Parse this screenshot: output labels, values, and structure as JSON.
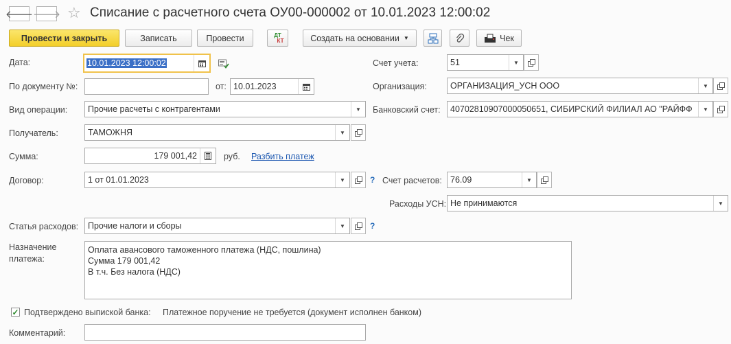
{
  "window": {
    "title": "Списание с расчетного счета ОУ00-000002 от 10.01.2023 12:00:02"
  },
  "toolbar": {
    "post_and_close": "Провести и закрыть",
    "write": "Записать",
    "post": "Провести",
    "dt_kt": "Дт Кт",
    "create_based_on": "Создать на основании",
    "check": "Чек"
  },
  "form": {
    "date_label": "Дата:",
    "date_value": "10.01.2023 12:00:02",
    "doc_no_label": "По документу №:",
    "doc_no_value": "",
    "from_label": "от:",
    "from_value": "10.01.2023",
    "operation_label": "Вид операции:",
    "operation_value": "Прочие расчеты с контрагентами",
    "recipient_label": "Получатель:",
    "recipient_value": "ТАМОЖНЯ",
    "amount_label": "Сумма:",
    "amount_value": "179 001,42",
    "currency": "руб.",
    "split_payment": "Разбить платеж",
    "contract_label": "Договор:",
    "contract_value": "1 от 01.01.2023",
    "expense_item_label": "Статья расходов:",
    "expense_item_value": "Прочие налоги и сборы",
    "purpose_label_1": "Назначение",
    "purpose_label_2": "платежа:",
    "purpose_lines": [
      "Оплата авансового таможенного платежа (НДС, пошлина)",
      "Сумма 179 001,42",
      "В т.ч. Без налога (НДС)"
    ],
    "confirmed_label": "Подтверждено выпиской банка:",
    "confirmed_checked": true,
    "confirmed_note": "Платежное поручение не требуется (документ исполнен банком)",
    "comment_label": "Комментарий:",
    "comment_value": "",
    "account_label": "Счет учета:",
    "account_value": "51",
    "organization_label": "Организация:",
    "organization_value": "ОРГАНИЗАЦИЯ_УСН ООО",
    "bank_account_label": "Банковский счет:",
    "bank_account_value": "40702810907000050651, СИБИРСКИЙ ФИЛИАЛ АО \"РАЙФФ",
    "settlement_account_label": "Счет расчетов:",
    "settlement_account_value": "76.09",
    "usn_expenses_label": "Расходы УСН:",
    "usn_expenses_value": "Не принимаются",
    "help_mark": "?"
  },
  "icons": {
    "back": "arrow-left-icon",
    "forward": "arrow-right-icon",
    "favorite": "star-icon",
    "calendar": "calendar-icon",
    "calculator": "calculator-icon",
    "dropdown": "chevron-down-icon",
    "open": "open-form-icon",
    "attach": "paperclip-icon",
    "structure": "structure-icon"
  },
  "colors": {
    "primary_button": "#f3cf2a",
    "link": "#1a56b0",
    "selection": "#3a6fc6",
    "checkmark": "#2c8a2c"
  }
}
